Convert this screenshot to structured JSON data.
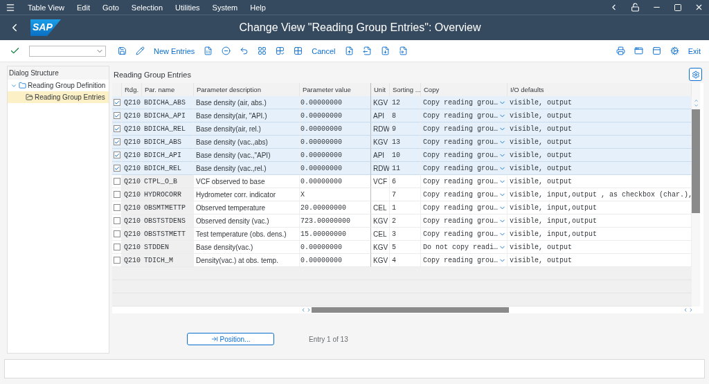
{
  "menu": [
    "Table View",
    "Edit",
    "Goto",
    "Selection",
    "Utilities",
    "System",
    "Help"
  ],
  "window": {
    "title": "Change View \"Reading Group Entries\": Overview",
    "logo": "SAP"
  },
  "toolbar": {
    "new_entries": "New Entries",
    "cancel": "Cancel",
    "exit": "Exit"
  },
  "dialog_structure": {
    "title": "Dialog Structure",
    "items": [
      {
        "label": "Reading Group Definition",
        "expanded": true,
        "selected": false,
        "children": [
          {
            "label": "Reading Group Entries",
            "selected": true
          }
        ]
      }
    ]
  },
  "table": {
    "title": "Reading Group Entries",
    "columns": [
      "Rdg.",
      "Par. name",
      "Parameter description",
      "Parameter value",
      "Unit",
      "Sorting ...",
      "Copy",
      "I/O defaults"
    ],
    "rows": [
      {
        "selected": true,
        "cells": [
          "Q210",
          "BDICHA_ABS",
          "Base density (air, abs.)",
          "0.00000000",
          "KGV",
          "12",
          "Copy reading grou…",
          "visible, output"
        ]
      },
      {
        "selected": true,
        "cells": [
          "Q210",
          "BDICHA_API",
          "Base density(air, \"API.)",
          "0.00000000",
          "API",
          "8",
          "Copy reading grou…",
          "visible, output"
        ]
      },
      {
        "selected": true,
        "cells": [
          "Q210",
          "BDICHA_REL",
          "Base density(air, rel.)",
          "0.00000000",
          "RDW",
          "9",
          "Copy reading grou…",
          "visible, output"
        ]
      },
      {
        "selected": true,
        "cells": [
          "Q210",
          "BDICH_ABS",
          "Base density (vac.,abs)",
          "0.00000000",
          "KGV",
          "13",
          "Copy reading grou…",
          "visible, output"
        ]
      },
      {
        "selected": true,
        "cells": [
          "Q210",
          "BDICH_API",
          "Base density (vac.,\"API)",
          "0.00000000",
          "API",
          "10",
          "Copy reading grou…",
          "visible, output"
        ]
      },
      {
        "selected": true,
        "cells": [
          "Q210",
          "BDICH_REL",
          "Base density (vac.,rel.)",
          "0.00000000",
          "RDW",
          "11",
          "Copy reading grou…",
          "visible, output"
        ]
      },
      {
        "selected": false,
        "cells": [
          "Q210",
          "CTPL_O_B",
          "VCF observed to base",
          "0.00000000",
          "VCF",
          "6",
          "Copy reading grou…",
          "visible, output"
        ]
      },
      {
        "selected": false,
        "cells": [
          "Q210",
          "HYDROCORR",
          "Hydrometer corr. indicator",
          "X",
          "",
          "7",
          "Copy reading grou…",
          "visible, input,output , as checkbox (char.),"
        ]
      },
      {
        "selected": false,
        "cells": [
          "Q210",
          "OBSMTMETTP",
          "Observed temperature",
          "20.00000000",
          "CEL",
          "1",
          "Copy reading grou…",
          "visible, input,output"
        ]
      },
      {
        "selected": false,
        "cells": [
          "Q210",
          "OBSTSTDENS",
          "Observed density (vac.)",
          "723.00000000",
          "KGV",
          "2",
          "Copy reading grou…",
          "visible, input,output"
        ]
      },
      {
        "selected": false,
        "cells": [
          "Q210",
          "OBSTSTMETT",
          "Test temperature (obs. dens.)",
          "15.00000000",
          "CEL",
          "3",
          "Copy reading grou…",
          "visible, input,output"
        ]
      },
      {
        "selected": false,
        "cells": [
          "Q210",
          "STDDEN",
          "Base density(vac.)",
          "0.00000000",
          "KGV",
          "5",
          "Do not copy readi…",
          "visible, output"
        ]
      },
      {
        "selected": false,
        "cells": [
          "Q210",
          "TDICH_M",
          "Density(vac.) at obs. temp.",
          "0.00000000",
          "KGV",
          "4",
          "Copy reading grou…",
          "visible, output"
        ]
      }
    ]
  },
  "position_button": "Position...",
  "entry_info": "Entry 1 of 13"
}
